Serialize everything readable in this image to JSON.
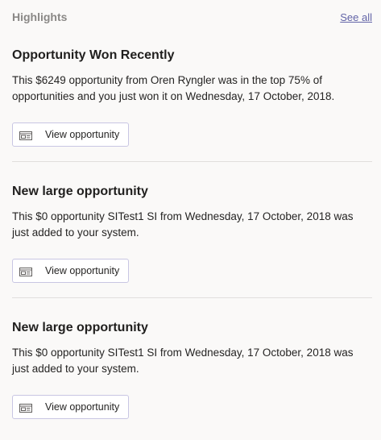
{
  "header": {
    "title": "Highlights",
    "see_all": "See all"
  },
  "cards": [
    {
      "title": "Opportunity Won Recently",
      "body": "This $6249 opportunity from Oren Ryngler was in the top 75% of opportunities and you just won it on Wednesday, 17 October, 2018.",
      "button_label": "View opportunity",
      "button_icon": "card-icon"
    },
    {
      "title": "New large opportunity",
      "body": "This $0 opportunity SITest1 SI from Wednesday, 17 October, 2018 was just added to your system.",
      "button_label": "View opportunity",
      "button_icon": "card-icon"
    },
    {
      "title": "New large opportunity",
      "body": "This $0 opportunity SITest1 SI from Wednesday, 17 October, 2018 was just added to your system.",
      "button_label": "View opportunity",
      "button_icon": "card-icon"
    }
  ],
  "colors": {
    "accent": "#6264a7",
    "header_text": "#8a8886",
    "divider": "#e1dfdd"
  }
}
